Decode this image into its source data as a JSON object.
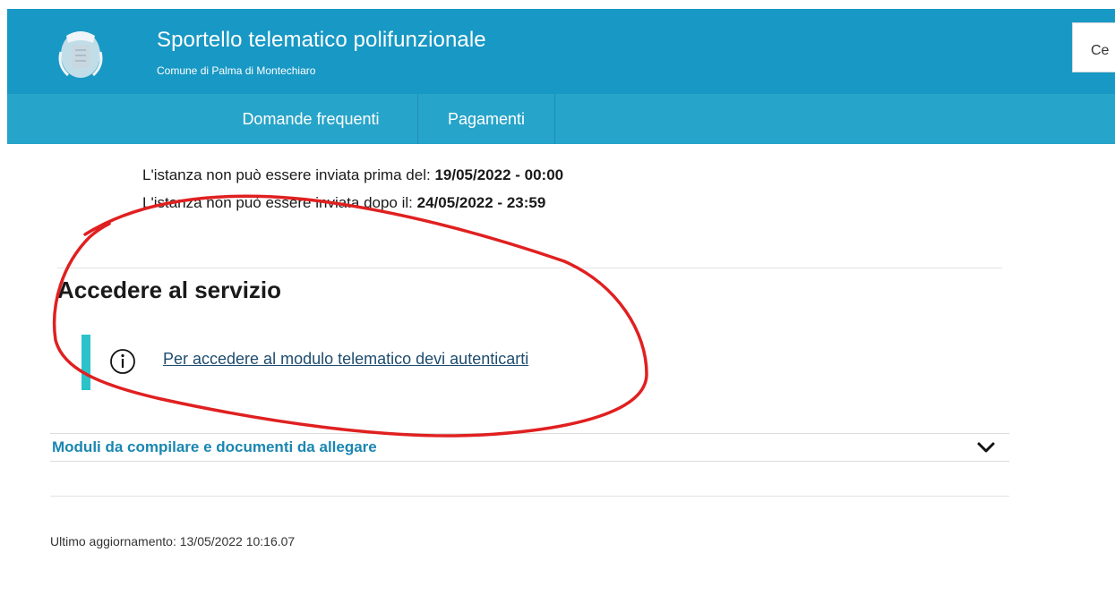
{
  "header": {
    "title": "Sportello telematico polifunzionale",
    "subtitle": "Comune di Palma di Montechiaro",
    "search_partial_text": "Ce",
    "crest_icon": "municipal-crest-icon"
  },
  "nav": {
    "items": [
      {
        "label": "Domande frequenti"
      },
      {
        "label": "Pagamenti"
      }
    ]
  },
  "dates": {
    "before_label": "L'istanza non può essere inviata prima del: ",
    "before_value": "19/05/2022 - 00:00",
    "after_label": "L'istanza non può essere inviata dopo il: ",
    "after_value": "24/05/2022 - 23:59"
  },
  "access": {
    "title": "Accedere al servizio",
    "info_icon": "info-icon",
    "auth_link": "Per accedere al modulo telematico devi autenticarti"
  },
  "accordion": {
    "label": "Moduli da compilare e documenti da allegare",
    "icon": "chevron-down-icon"
  },
  "footer": {
    "last_update": "Ultimo aggiornamento: 13/05/2022 10:16.07"
  },
  "colors": {
    "header_bg": "#1898c4",
    "nav_bg": "#27a4c9",
    "accent_bar": "#2bc2c9",
    "link": "#1e4c6e",
    "accordion_text": "#1a86b1",
    "annotation_stroke": "#e02020"
  }
}
